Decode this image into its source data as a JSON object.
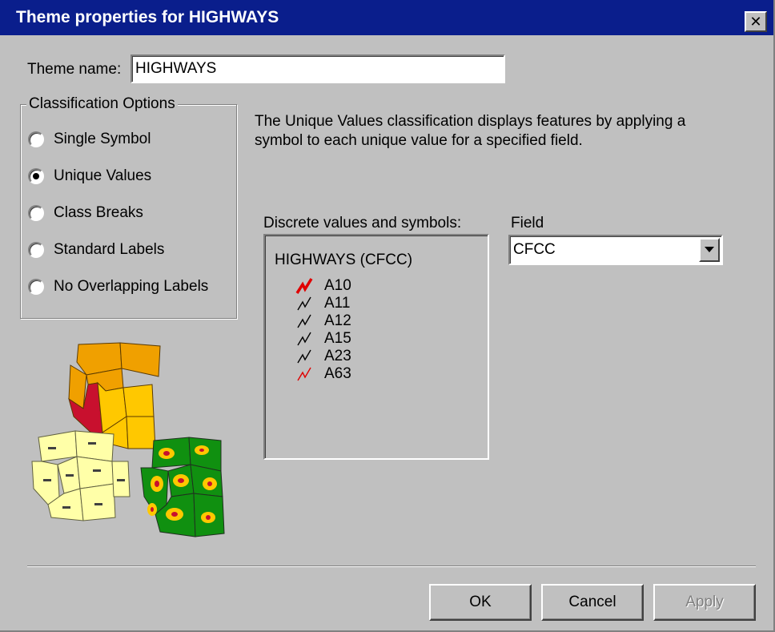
{
  "window": {
    "title": "Theme properties for HIGHWAYS",
    "close_glyph": "✕"
  },
  "theme_name": {
    "label": "Theme name:",
    "value": "HIGHWAYS"
  },
  "classification": {
    "title": "Classification Options",
    "options": [
      {
        "label": "Single Symbol",
        "checked": false
      },
      {
        "label": "Unique Values",
        "checked": true
      },
      {
        "label": "Class Breaks",
        "checked": false
      },
      {
        "label": "Standard Labels",
        "checked": false
      },
      {
        "label": "No Overlapping Labels",
        "checked": false
      }
    ]
  },
  "description": "The Unique Values classification displays features by applying a symbol to each unique value for a specified field.",
  "discrete": {
    "label": "Discrete values and symbols:",
    "header": "HIGHWAYS (CFCC)",
    "items": [
      {
        "value": "A10",
        "color": "#e00000",
        "thick": true
      },
      {
        "value": "A11",
        "color": "#000000",
        "thick": false
      },
      {
        "value": "A12",
        "color": "#000000",
        "thick": false
      },
      {
        "value": "A15",
        "color": "#000000",
        "thick": false
      },
      {
        "value": "A23",
        "color": "#000000",
        "thick": false
      },
      {
        "value": "A63",
        "color": "#e00000",
        "thick": false
      }
    ]
  },
  "field": {
    "label": "Field",
    "selected": "CFCC"
  },
  "buttons": {
    "ok": "OK",
    "cancel": "Cancel",
    "apply": "Apply"
  },
  "colors": {
    "titlebar": "#0a1e8c",
    "face": "#c0c0c0",
    "map_orange": "#f0a000",
    "map_red": "#c8102e",
    "map_yellow": "#ffc800",
    "map_cream": "#ffffa8",
    "map_green": "#109010"
  }
}
